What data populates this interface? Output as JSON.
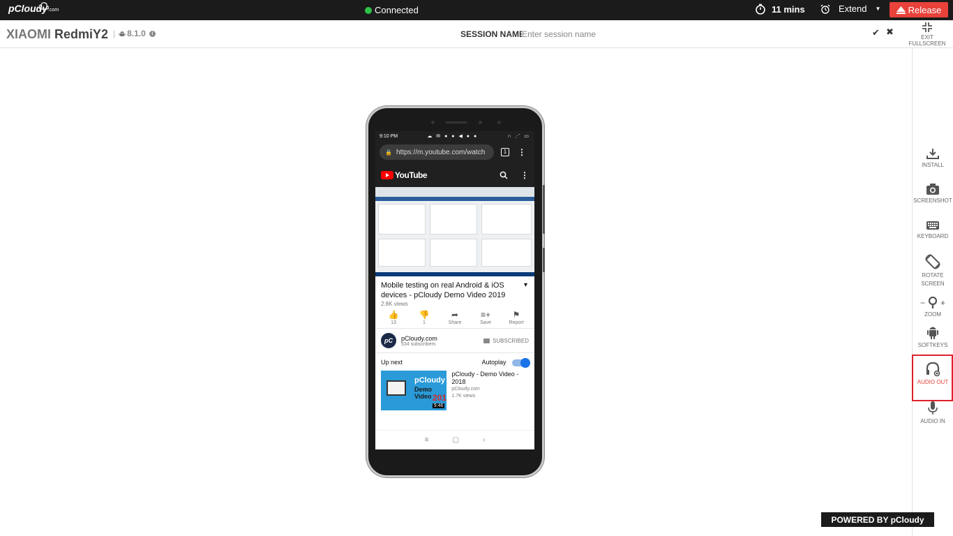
{
  "topbar": {
    "logo": "pCloudy",
    "logo_suffix": ".com",
    "status": "Connected",
    "timer": "11 mins",
    "extend_label": "Extend",
    "release_label": "Release"
  },
  "header": {
    "device_brand": "XIAOMI",
    "device_model": "RedmiY2",
    "android_version": "8.1.0",
    "session_label": "SESSION NAME",
    "session_placeholder": "Enter session name",
    "exit_fullscreen": "EXIT FULLSCREEN"
  },
  "sidebar": {
    "install": "INSTALL",
    "screenshot": "SCREENSHOT",
    "keyboard": "KEYBOARD",
    "rotate": "ROTATE",
    "rotate2": "SCREEN",
    "zoom_minus": "−",
    "zoom_plus": "+",
    "zoom": "ZOOM",
    "softkeys": "SOFTKEYS",
    "audio_out": "AUDIO OUT",
    "audio_in": "AUDIO IN"
  },
  "phone": {
    "time": "9:10 PM",
    "url": "https://m.youtube.com/watch",
    "tab_count": "1",
    "yt_logo": "YouTube",
    "video_title": "Mobile testing on real Android & iOS devices - pCloudy Demo Video 2019",
    "views": "2.8K views",
    "actions": [
      {
        "icon": "👍",
        "label": "13"
      },
      {
        "icon": "👎",
        "label": "1"
      },
      {
        "icon": "➦",
        "label": "Share"
      },
      {
        "icon": "≡+",
        "label": "Save"
      },
      {
        "icon": "⚑",
        "label": "Report"
      }
    ],
    "channel_name": "pCloudy.com",
    "channel_subs": "534 subscribers",
    "channel_avatar": "pC",
    "subscribed": "SUBSCRIBED",
    "up_next": "Up next",
    "autoplay": "Autoplay",
    "rec_title": "pCloudy - Demo Video - 2018",
    "rec_channel": "pCloudy.com",
    "rec_views": "1.7K views",
    "rec_duration": "9:46",
    "thumb_text1": "pCloudy",
    "thumb_text2": "Demo Video",
    "thumb_text3": "2018"
  },
  "footer": {
    "powered": "POWERED BY pCloudy"
  },
  "colors": {
    "release": "#e8423b",
    "connected": "#2ec24a",
    "highlight": "#e0202a"
  }
}
